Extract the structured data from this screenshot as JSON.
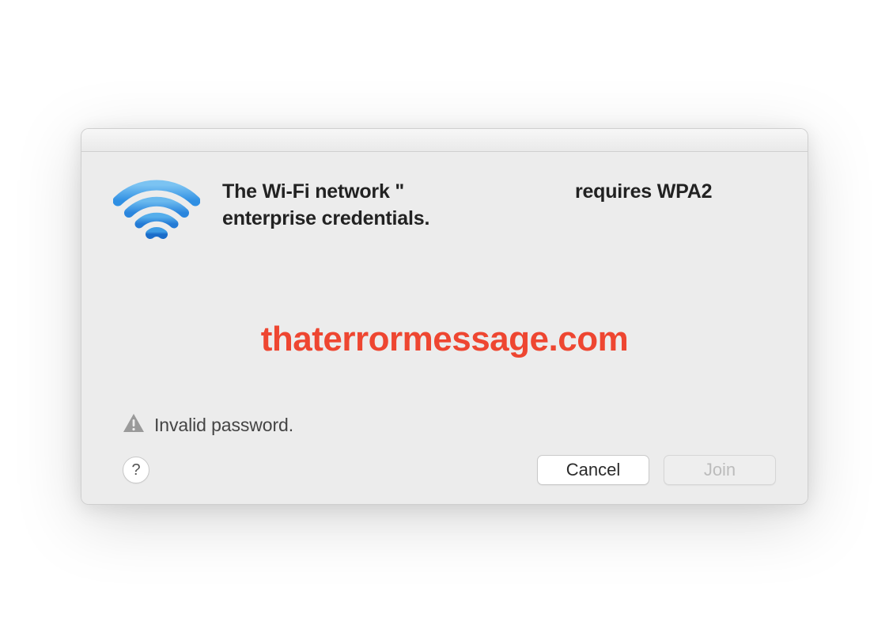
{
  "dialog": {
    "title_line1": "The Wi-Fi network \"",
    "title_network": "",
    "title_line2": "requires WPA2 enterprise credentials."
  },
  "watermark": "thaterrormessage.com",
  "status": {
    "message": "Invalid password."
  },
  "buttons": {
    "help": "?",
    "cancel": "Cancel",
    "join": "Join"
  }
}
